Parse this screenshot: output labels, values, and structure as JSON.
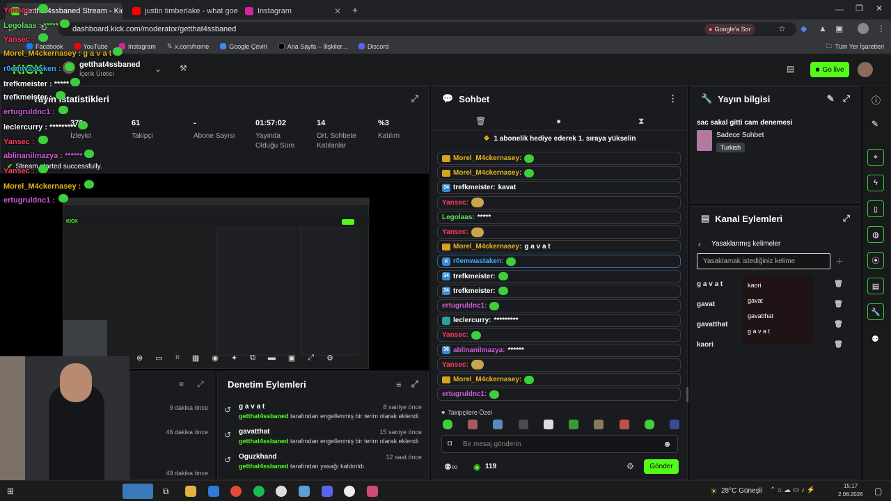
{
  "browser": {
    "tabs": [
      {
        "label": "getthat4ssbaned Stream - Kick",
        "active": true
      },
      {
        "label": "justin timberlake - what goes a",
        "active": false
      },
      {
        "label": "Instagram",
        "active": false
      }
    ],
    "url": "dashboard.kick.com/moderator/getthat4ssbaned",
    "google_btn": "Google'a Sor",
    "bookmarks": [
      "Facebook",
      "YouTube",
      "Instagram",
      "x.com/home",
      "Google Çeviri",
      "Ana Sayfa – İlişkiler...",
      "Discord"
    ],
    "all_bookmarks": "Tüm Yer İşaretleri"
  },
  "header": {
    "channel_name": "getthat4ssbaned",
    "role": "İçerik Üretici",
    "go_live": "Go live"
  },
  "stats": {
    "title": "Yayın İstatistikleri",
    "items": [
      {
        "value": "370",
        "label": "İzleyici"
      },
      {
        "value": "61",
        "label": "Takipçi"
      },
      {
        "value": "-",
        "label": "Abone Sayısı"
      },
      {
        "value": "01:57:02",
        "label": "Yayında Olduğu Süre"
      },
      {
        "value": "14",
        "label": "Ort. Sohbete Katılanlar"
      },
      {
        "value": "%3",
        "label": "Katılım"
      }
    ],
    "stream_started": "Stream started successfully."
  },
  "activity": {
    "times": [
      "9 dakika önce",
      "46 dakika önce",
      "49 dakika önce"
    ]
  },
  "moderation": {
    "title": "Denetim Eylemleri",
    "rows": [
      {
        "term": "g a v a t",
        "time": "8 saniye önce",
        "user": "getthat4ssbaned",
        "desc": "tarafından engellenmiş bir terim olarak eklendi"
      },
      {
        "term": "gavatthat",
        "time": "15 saniye önce",
        "user": "getthat4ssbaned",
        "desc": "tarafından engellenmiş bir terim olarak eklendi"
      },
      {
        "term": "Oguzkhand",
        "time": "12 saat önce",
        "user": "getthat4ssbaned",
        "desc": "tarafından yasağı kaldırıldı"
      }
    ]
  },
  "chat": {
    "title": "Sohbet",
    "gift_banner": "1 abonelik hediye ederek 1. sıraya yükselin",
    "messages": [
      {
        "user": "Morel_M4ckernasey:",
        "color": "#e7b419",
        "text": "",
        "badge": "crown",
        "emote": "em"
      },
      {
        "user": "Morel_M4ckernasey:",
        "color": "#e7b419",
        "text": "",
        "badge": "crown",
        "emote": "em"
      },
      {
        "user": "trefkmeister:",
        "color": "#ffffff",
        "text": "kavat",
        "badge": "34",
        "emote": ""
      },
      {
        "user": "Yansec:",
        "color": "#ff3b5c",
        "text": "",
        "badge": "",
        "emote": "pepe"
      },
      {
        "user": "Legolaas:",
        "color": "#5be35b",
        "text": "*****",
        "badge": "",
        "emote": ""
      },
      {
        "user": "Yansec:",
        "color": "#ff3b5c",
        "text": "",
        "badge": "",
        "emote": "pepe"
      },
      {
        "user": "Morel_M4ckernasey:",
        "color": "#e7b419",
        "text": "g a v a t",
        "badge": "crown",
        "emote": ""
      },
      {
        "user": "r0emwastaken:",
        "color": "#3fa9ff",
        "text": "",
        "badge": "mod",
        "emote": "em"
      },
      {
        "user": "trefkmeister:",
        "color": "#ffffff",
        "text": "",
        "badge": "34",
        "emote": "em"
      },
      {
        "user": "trefkmeister:",
        "color": "#ffffff",
        "text": "",
        "badge": "34",
        "emote": "em"
      },
      {
        "user": "ertugruldnc1:",
        "color": "#d05bd6",
        "text": "",
        "badge": "",
        "emote": "em"
      },
      {
        "user": "leclercurry:",
        "color": "#ffffff",
        "text": "*********",
        "badge": "sub",
        "emote": ""
      },
      {
        "user": "Yansec:",
        "color": "#ff3b5c",
        "text": "",
        "badge": "",
        "emote": "em"
      },
      {
        "user": "ablinanilmazya:",
        "color": "#d05bd6",
        "text": "******",
        "badge": "36",
        "emote": ""
      },
      {
        "user": "Yansec:",
        "color": "#ff3b5c",
        "text": "",
        "badge": "",
        "emote": "pepe"
      },
      {
        "user": "Morel_M4ckernasey:",
        "color": "#e7b419",
        "text": "",
        "badge": "crown",
        "emote": "em"
      },
      {
        "user": "ertugruldnc1:",
        "color": "#d05bd6",
        "text": "",
        "badge": "",
        "emote": "em"
      }
    ],
    "follower_only": "Takipçilere Özel",
    "input_placeholder": "Bir mesaj gönderin",
    "points": "119",
    "send": "Gönder"
  },
  "stream_info": {
    "title": "Yayın bilgisi",
    "stream_title": "sac sakal gitti cam denemesi",
    "category": "Sadece Sohbet",
    "language": "Turkish"
  },
  "channel_actions": {
    "title": "Kanal Eylemleri",
    "section": "Yasaklanmış kelimeler",
    "input_placeholder": "Yasaklamak istediğiniz kelime",
    "words": [
      "g a v a t",
      "gavat",
      "gavatthat",
      "kaori"
    ],
    "suggestions": [
      "kaori",
      "gavat",
      "gavatthat",
      "g a v a t"
    ]
  },
  "overlay": {
    "lines": [
      {
        "text": "Yansec : ",
        "color": "#ff3b5c"
      },
      {
        "text": "Legolaas : *****",
        "color": "#5be35b"
      },
      {
        "text": "Yansec : ",
        "color": "#ff3b5c"
      },
      {
        "text": "Morel_M4ckernasey : g a v a t",
        "color": "#e7b419"
      },
      {
        "text": "r0emwastaken : ",
        "color": "#3fa9ff"
      },
      {
        "text": "trefkmeister : *****",
        "color": "#ffffff"
      },
      {
        "text": "trefkmeister : ",
        "color": "#ffffff"
      },
      {
        "text": "ertugruldnc1 : ",
        "color": "#d05bd6"
      },
      {
        "text": "leclercurry : *********",
        "color": "#ffffff"
      },
      {
        "text": "Yansec : ",
        "color": "#ff3b5c"
      },
      {
        "text": "ablinanilmazya : ******",
        "color": "#d05bd6"
      },
      {
        "text": "Yansec : ",
        "color": "#ff3b5c"
      },
      {
        "text": "Morel_M4ckernasey : ",
        "color": "#e7b419"
      },
      {
        "text": "ertugruldnc1 : ",
        "color": "#d05bd6"
      }
    ]
  },
  "taskbar": {
    "weather": "28°C Güneşli",
    "time": "15:17",
    "date": "2.08.2026"
  }
}
